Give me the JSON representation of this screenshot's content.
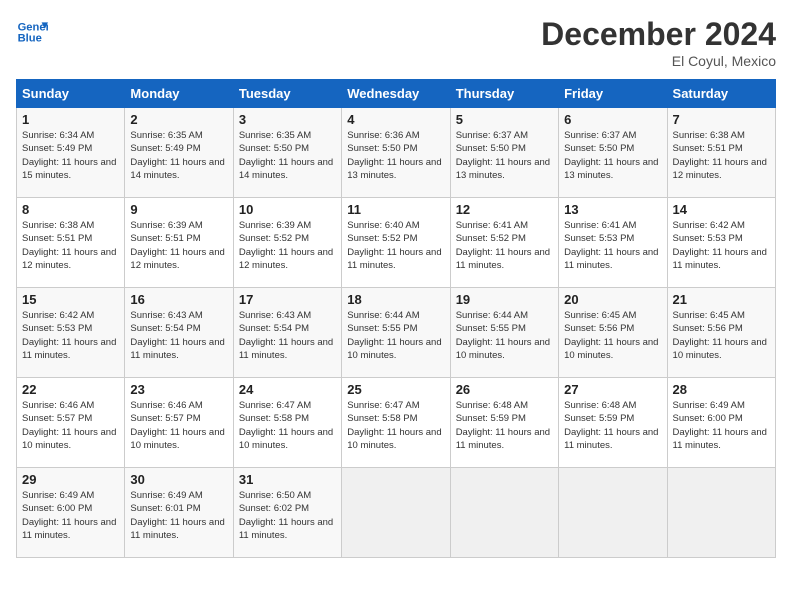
{
  "header": {
    "logo_line1": "General",
    "logo_line2": "Blue",
    "month_title": "December 2024",
    "location": "El Coyul, Mexico"
  },
  "weekdays": [
    "Sunday",
    "Monday",
    "Tuesday",
    "Wednesday",
    "Thursday",
    "Friday",
    "Saturday"
  ],
  "weeks": [
    [
      {
        "day": "1",
        "sunrise": "6:34 AM",
        "sunset": "5:49 PM",
        "daylight": "11 hours and 15 minutes."
      },
      {
        "day": "2",
        "sunrise": "6:35 AM",
        "sunset": "5:49 PM",
        "daylight": "11 hours and 14 minutes."
      },
      {
        "day": "3",
        "sunrise": "6:35 AM",
        "sunset": "5:50 PM",
        "daylight": "11 hours and 14 minutes."
      },
      {
        "day": "4",
        "sunrise": "6:36 AM",
        "sunset": "5:50 PM",
        "daylight": "11 hours and 13 minutes."
      },
      {
        "day": "5",
        "sunrise": "6:37 AM",
        "sunset": "5:50 PM",
        "daylight": "11 hours and 13 minutes."
      },
      {
        "day": "6",
        "sunrise": "6:37 AM",
        "sunset": "5:50 PM",
        "daylight": "11 hours and 13 minutes."
      },
      {
        "day": "7",
        "sunrise": "6:38 AM",
        "sunset": "5:51 PM",
        "daylight": "11 hours and 12 minutes."
      }
    ],
    [
      {
        "day": "8",
        "sunrise": "6:38 AM",
        "sunset": "5:51 PM",
        "daylight": "11 hours and 12 minutes."
      },
      {
        "day": "9",
        "sunrise": "6:39 AM",
        "sunset": "5:51 PM",
        "daylight": "11 hours and 12 minutes."
      },
      {
        "day": "10",
        "sunrise": "6:39 AM",
        "sunset": "5:52 PM",
        "daylight": "11 hours and 12 minutes."
      },
      {
        "day": "11",
        "sunrise": "6:40 AM",
        "sunset": "5:52 PM",
        "daylight": "11 hours and 11 minutes."
      },
      {
        "day": "12",
        "sunrise": "6:41 AM",
        "sunset": "5:52 PM",
        "daylight": "11 hours and 11 minutes."
      },
      {
        "day": "13",
        "sunrise": "6:41 AM",
        "sunset": "5:53 PM",
        "daylight": "11 hours and 11 minutes."
      },
      {
        "day": "14",
        "sunrise": "6:42 AM",
        "sunset": "5:53 PM",
        "daylight": "11 hours and 11 minutes."
      }
    ],
    [
      {
        "day": "15",
        "sunrise": "6:42 AM",
        "sunset": "5:53 PM",
        "daylight": "11 hours and 11 minutes."
      },
      {
        "day": "16",
        "sunrise": "6:43 AM",
        "sunset": "5:54 PM",
        "daylight": "11 hours and 11 minutes."
      },
      {
        "day": "17",
        "sunrise": "6:43 AM",
        "sunset": "5:54 PM",
        "daylight": "11 hours and 11 minutes."
      },
      {
        "day": "18",
        "sunrise": "6:44 AM",
        "sunset": "5:55 PM",
        "daylight": "11 hours and 10 minutes."
      },
      {
        "day": "19",
        "sunrise": "6:44 AM",
        "sunset": "5:55 PM",
        "daylight": "11 hours and 10 minutes."
      },
      {
        "day": "20",
        "sunrise": "6:45 AM",
        "sunset": "5:56 PM",
        "daylight": "11 hours and 10 minutes."
      },
      {
        "day": "21",
        "sunrise": "6:45 AM",
        "sunset": "5:56 PM",
        "daylight": "11 hours and 10 minutes."
      }
    ],
    [
      {
        "day": "22",
        "sunrise": "6:46 AM",
        "sunset": "5:57 PM",
        "daylight": "11 hours and 10 minutes."
      },
      {
        "day": "23",
        "sunrise": "6:46 AM",
        "sunset": "5:57 PM",
        "daylight": "11 hours and 10 minutes."
      },
      {
        "day": "24",
        "sunrise": "6:47 AM",
        "sunset": "5:58 PM",
        "daylight": "11 hours and 10 minutes."
      },
      {
        "day": "25",
        "sunrise": "6:47 AM",
        "sunset": "5:58 PM",
        "daylight": "11 hours and 10 minutes."
      },
      {
        "day": "26",
        "sunrise": "6:48 AM",
        "sunset": "5:59 PM",
        "daylight": "11 hours and 11 minutes."
      },
      {
        "day": "27",
        "sunrise": "6:48 AM",
        "sunset": "5:59 PM",
        "daylight": "11 hours and 11 minutes."
      },
      {
        "day": "28",
        "sunrise": "6:49 AM",
        "sunset": "6:00 PM",
        "daylight": "11 hours and 11 minutes."
      }
    ],
    [
      {
        "day": "29",
        "sunrise": "6:49 AM",
        "sunset": "6:00 PM",
        "daylight": "11 hours and 11 minutes."
      },
      {
        "day": "30",
        "sunrise": "6:49 AM",
        "sunset": "6:01 PM",
        "daylight": "11 hours and 11 minutes."
      },
      {
        "day": "31",
        "sunrise": "6:50 AM",
        "sunset": "6:02 PM",
        "daylight": "11 hours and 11 minutes."
      },
      null,
      null,
      null,
      null
    ]
  ]
}
